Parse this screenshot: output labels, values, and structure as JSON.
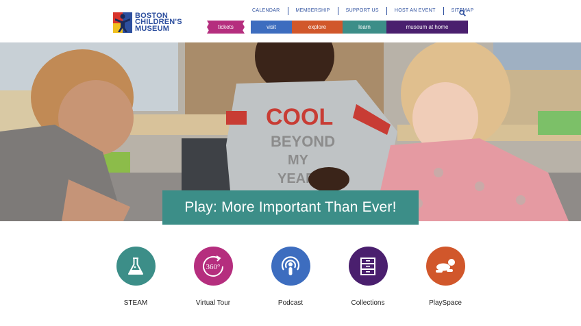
{
  "logo": {
    "line1": "BOSTON",
    "line2": "CHILDREN'S",
    "line3": "MUSEUM"
  },
  "utility_nav": [
    "CALENDAR",
    "MEMBERSHIP",
    "SUPPORT US",
    "HOST AN EVENT",
    "SITEMAP"
  ],
  "main_nav": {
    "tickets": "tickets",
    "items": [
      {
        "label": "visit",
        "color": "#3d6dbf"
      },
      {
        "label": "explore",
        "color": "#d1572b"
      },
      {
        "label": "learn",
        "color": "#3c8e88"
      },
      {
        "label": "museum at home",
        "color": "#4a1f6e"
      }
    ]
  },
  "hero": {
    "headline": "Play: More Important Than Ever!",
    "shirt_text": [
      "COOL",
      "BEYOND",
      "MY",
      "YEARS"
    ]
  },
  "features": [
    {
      "label": "STEAM",
      "icon": "flask-icon",
      "color": "#3c8e88"
    },
    {
      "label": "Virtual Tour",
      "icon": "360-icon",
      "color": "#b52e7e"
    },
    {
      "label": "Podcast",
      "icon": "podcast-icon",
      "color": "#3d6dbf"
    },
    {
      "label": "Collections",
      "icon": "cabinet-icon",
      "color": "#4a1f6e"
    },
    {
      "label": "PlaySpace",
      "icon": "crawling-baby-icon",
      "color": "#d1572b"
    }
  ],
  "colors": {
    "brand_blue": "#2d4f9e",
    "tickets": "#b52e7e",
    "banner": "#3c8e88"
  }
}
